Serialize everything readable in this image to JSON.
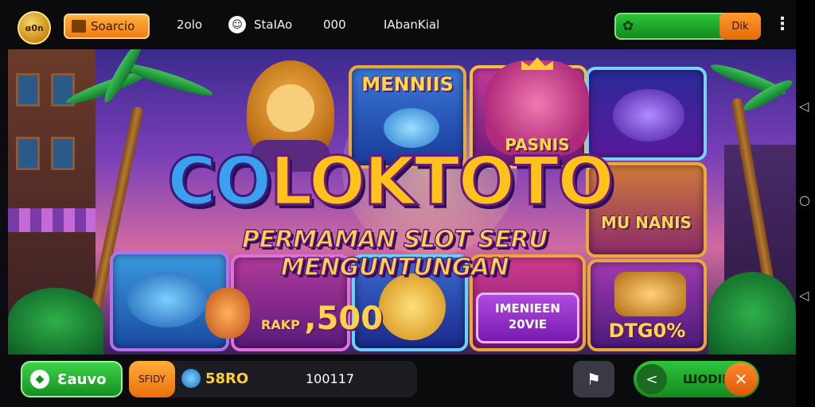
{
  "topbar": {
    "coin_label": "ɞ0ח",
    "search_label": "Soarcio",
    "text_1": "2olo",
    "text_2": "StaIAo",
    "text_3": "000",
    "text_4": "IAbanKial",
    "green_button_label": "Dik"
  },
  "hero": {
    "logo_part_1": "CO",
    "logo_part_2": "LOKTOTO",
    "tagline": "PERMAMAN SLOT SERU MENGUNTUNGAN",
    "tile_top_left_label": "MENNIIS",
    "tile_top_center_label": "PASNIS",
    "tile_mid_right_label": "MU NANIS",
    "price_prefix": "RAKP",
    "price_value": ",500",
    "member_line_1": "IMENIEEN",
    "member_line_2": "20VIE",
    "tile_bottom_right_label": "DTG0%"
  },
  "bottombar": {
    "play_label": "Ɛauvo",
    "bet_label": "SFIDY",
    "bet_value": "58RO",
    "counter": "100117",
    "share_label": "ШODIK"
  },
  "colors": {
    "accent_orange": "#f07b12",
    "accent_green": "#14911f",
    "gold": "#ffc21a",
    "logo_blue": "#3aa0f0"
  }
}
